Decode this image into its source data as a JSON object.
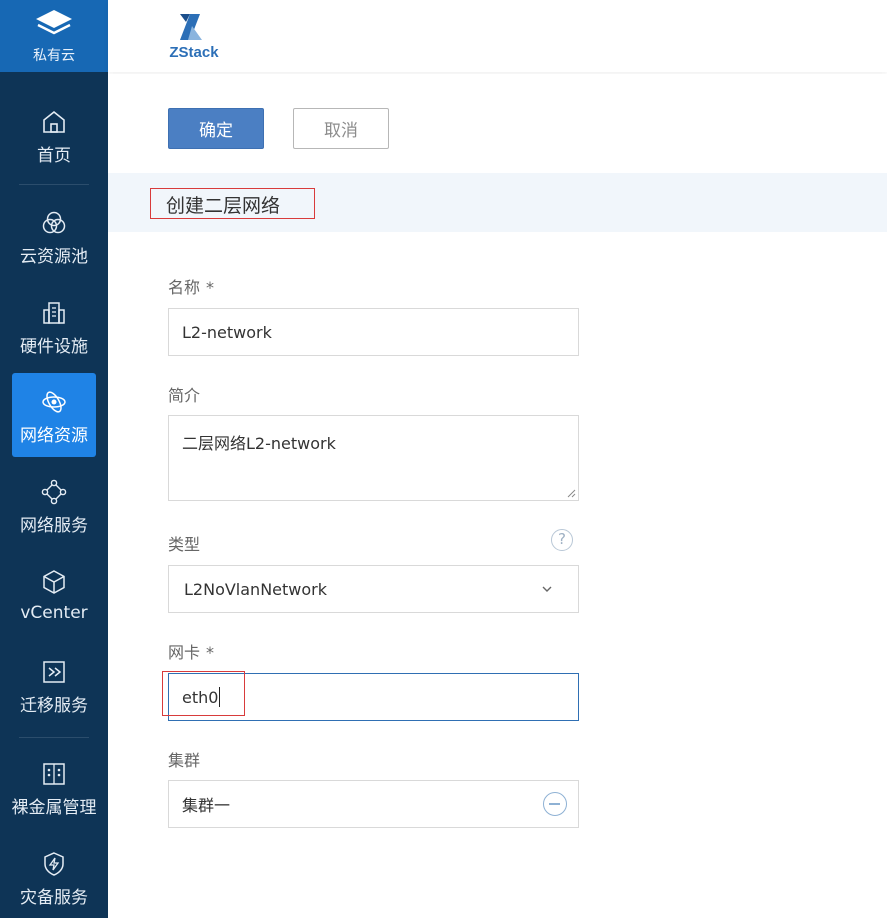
{
  "brand": {
    "label": "私有云",
    "icon": "layers-icon"
  },
  "sidebar": {
    "items": [
      {
        "label": "首页",
        "icon": "home-icon",
        "active": false
      },
      {
        "label": "云资源池",
        "icon": "resource-pool-icon",
        "active": false
      },
      {
        "label": "硬件设施",
        "icon": "building-icon",
        "active": false
      },
      {
        "label": "网络资源",
        "icon": "orbit-icon",
        "active": true
      },
      {
        "label": "网络服务",
        "icon": "network-nodes-icon",
        "active": false
      },
      {
        "label": "vCenter",
        "icon": "cube-icon",
        "active": false
      },
      {
        "label": "迁移服务",
        "icon": "migrate-icon",
        "active": false
      },
      {
        "label": "裸金属管理",
        "icon": "server-icon",
        "active": false
      },
      {
        "label": "灾备服务",
        "icon": "shield-bolt-icon",
        "active": false
      }
    ]
  },
  "header": {
    "logo_text": "ZStack"
  },
  "toolbar": {
    "ok_label": "确定",
    "cancel_label": "取消"
  },
  "form": {
    "title": "创建二层网络",
    "name": {
      "label": "名称",
      "required_mark": "*",
      "value": "L2-network"
    },
    "description": {
      "label": "简介",
      "value": "二层网络L2-network"
    },
    "type": {
      "label": "类型",
      "value": "L2NoVlanNetwork",
      "help": "?"
    },
    "nic": {
      "label": "网卡",
      "required_mark": "*",
      "value": "eth0"
    },
    "cluster": {
      "label": "集群",
      "value": "集群一"
    }
  },
  "colors": {
    "sidebar_bg": "#0e3456",
    "brand_bg": "#1768b4",
    "active_bg": "#1f83e6",
    "primary_button": "#4b7fc3",
    "highlight_border": "#d83b3b"
  }
}
